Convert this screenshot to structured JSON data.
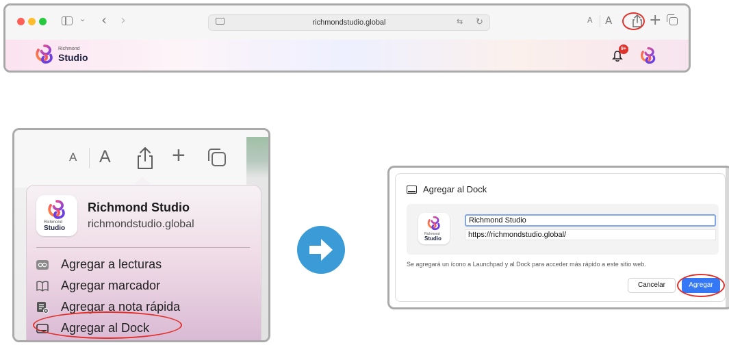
{
  "browser": {
    "url": "richmondstudio.global",
    "text_size_small": "A",
    "text_size_large": "A",
    "notification_badge": "9+"
  },
  "brand": {
    "line1": "Richmond",
    "line2": "Studio"
  },
  "share_menu": {
    "site_title": "Richmond Studio",
    "site_url": "richmondstudio.global",
    "items": [
      {
        "label": "Agregar a lecturas",
        "icon": "reading-list-icon"
      },
      {
        "label": "Agregar marcador",
        "icon": "book-icon"
      },
      {
        "label": "Agregar a nota rápida",
        "icon": "quick-note-icon"
      },
      {
        "label": "Agregar al Dock",
        "icon": "dock-icon"
      }
    ]
  },
  "dialog": {
    "title": "Agregar al Dock",
    "name_value": "Richmond Studio",
    "url_value": "https://richmondstudio.global/",
    "note": "Se agregará un ícono a Launchpad y al Dock para acceder más rápido a este sitio web.",
    "cancel_label": "Cancelar",
    "add_label": "Agregar"
  },
  "colors": {
    "highlight": "#e0312d",
    "accent_blue": "#3478f6",
    "arrow_blue": "#3b9bd6"
  }
}
